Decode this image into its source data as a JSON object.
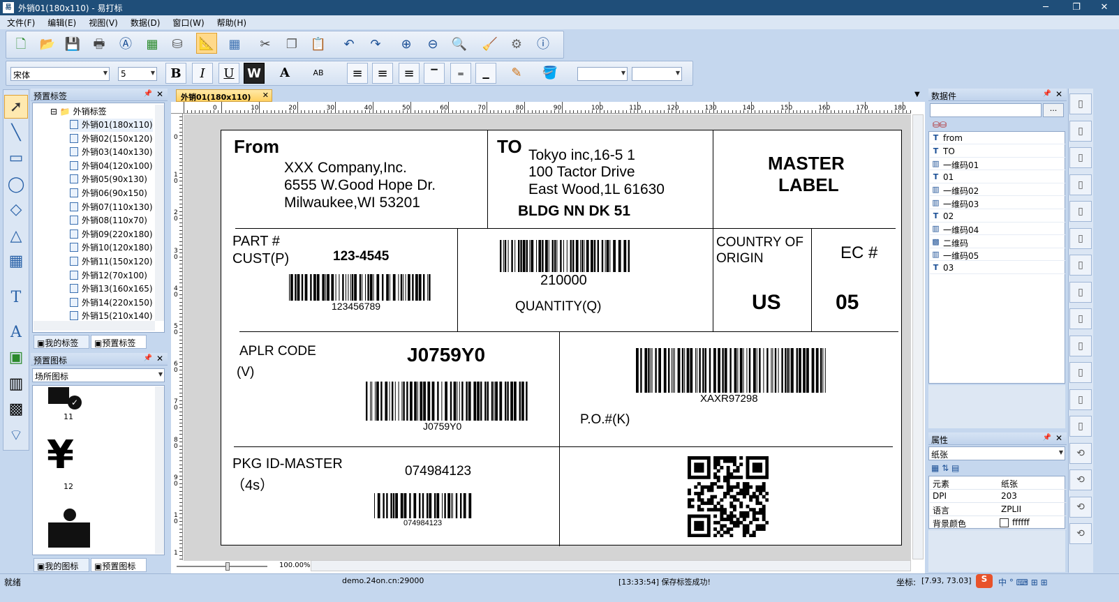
{
  "window": {
    "title": "外销01(180x110) - 易打标"
  },
  "menu": [
    "文件(F)",
    "编辑(E)",
    "视图(V)",
    "数据(D)",
    "窗口(W)",
    "帮助(H)"
  ],
  "toolbar": {
    "font_name": "宋体",
    "font_size": "5",
    "bold": "B",
    "italic": "I",
    "underline": "U",
    "wide": "W"
  },
  "left_panel": {
    "preset_labels_title": "预置标签",
    "folder": "外销标签",
    "items": [
      "外销01(180x110)",
      "外销02(150x120)",
      "外销03(140x130)",
      "外销04(120x100)",
      "外销05(90x130)",
      "外销06(90x150)",
      "外销07(110x130)",
      "外销08(110x70)",
      "外销09(220x180)",
      "外销10(120x180)",
      "外销11(150x120)",
      "外销12(70x100)",
      "外销13(160x165)",
      "外销14(220x150)",
      "外销15(210x140)"
    ],
    "tabs": [
      "我的标签",
      "预置标签"
    ],
    "preset_icons_title": "预置图标",
    "icon_category": "场所图标",
    "icon_numbers": [
      "11",
      "12"
    ],
    "icon_tabs": [
      "我的图标",
      "预置图标"
    ]
  },
  "doc_tab": "外销01(180x110)",
  "ruler_h": [
    "0",
    "10",
    "20",
    "30",
    "40",
    "50",
    "60",
    "70",
    "80",
    "90",
    "100",
    "110",
    "120",
    "130",
    "140",
    "150",
    "160",
    "170",
    "180"
  ],
  "ruler_v": [
    "0",
    "1\n0",
    "2\n0",
    "3\n0",
    "4\n0",
    "5\n0",
    "6\n0",
    "7\n0",
    "8\n0",
    "9\n0",
    "1\n0",
    "1"
  ],
  "label": {
    "from_title": "From",
    "from_lines": [
      "XXX Company,Inc.",
      "6555 W.Good Hope Dr.",
      "Milwaukee,WI 53201"
    ],
    "to_title": "TO",
    "to_lines": [
      "Tokyo inc,16-5 1",
      "100 Tactor Drive",
      "East Wood,1L 61630"
    ],
    "to_bldg": "BLDG NN DK 51",
    "master": [
      "MASTER",
      "LABEL"
    ],
    "part_label": [
      "PART #",
      "CUST(P)"
    ],
    "part_value": "123-4545",
    "part_barcode": "123456789",
    "qty_barcode": "210000",
    "qty_label": "QUANTITY(Q)",
    "country_label": [
      "COUNTRY OF",
      "ORIGIN"
    ],
    "country_value": "US",
    "ec_label": "EC #",
    "ec_value": "05",
    "aplr_label": "APLR CODE",
    "aplr_v": "(V)",
    "aplr_value": "J0759Y0",
    "aplr_barcode": "J0759Y0",
    "po_barcode": "XAXR97298",
    "po_label": "P.O.#(K)",
    "pkg_label": "PKG ID-MASTER",
    "pkg_4s": "（4s）",
    "pkg_value": "074984123",
    "pkg_barcode": "074984123"
  },
  "zoom": "100.00%",
  "right_panel": {
    "data_title": "数据件",
    "data_items": [
      {
        "icon": "T",
        "name": "from"
      },
      {
        "icon": "T",
        "name": "TO"
      },
      {
        "icon": "bar",
        "name": "一维码01"
      },
      {
        "icon": "T",
        "name": "01"
      },
      {
        "icon": "bar",
        "name": "一维码02"
      },
      {
        "icon": "bar",
        "name": "一维码03"
      },
      {
        "icon": "T",
        "name": "02"
      },
      {
        "icon": "bar",
        "name": "一维码04"
      },
      {
        "icon": "qr",
        "name": "二维码"
      },
      {
        "icon": "bar",
        "name": "一维码05"
      },
      {
        "icon": "T",
        "name": "03"
      }
    ],
    "props_title": "属性",
    "props_select": "纸张",
    "props": [
      {
        "k": "元素",
        "v": "纸张"
      },
      {
        "k": "DPI",
        "v": "203"
      },
      {
        "k": "语言",
        "v": "ZPLII"
      },
      {
        "k": "背景颜色",
        "v": "ffffff"
      }
    ]
  },
  "status": {
    "ready": "就绪",
    "server": "demo.24on.cn:29000",
    "msg": "[13:33:54] 保存标签成功!",
    "coord_label": "坐标:",
    "coord": "[7.93, 73.03]"
  }
}
